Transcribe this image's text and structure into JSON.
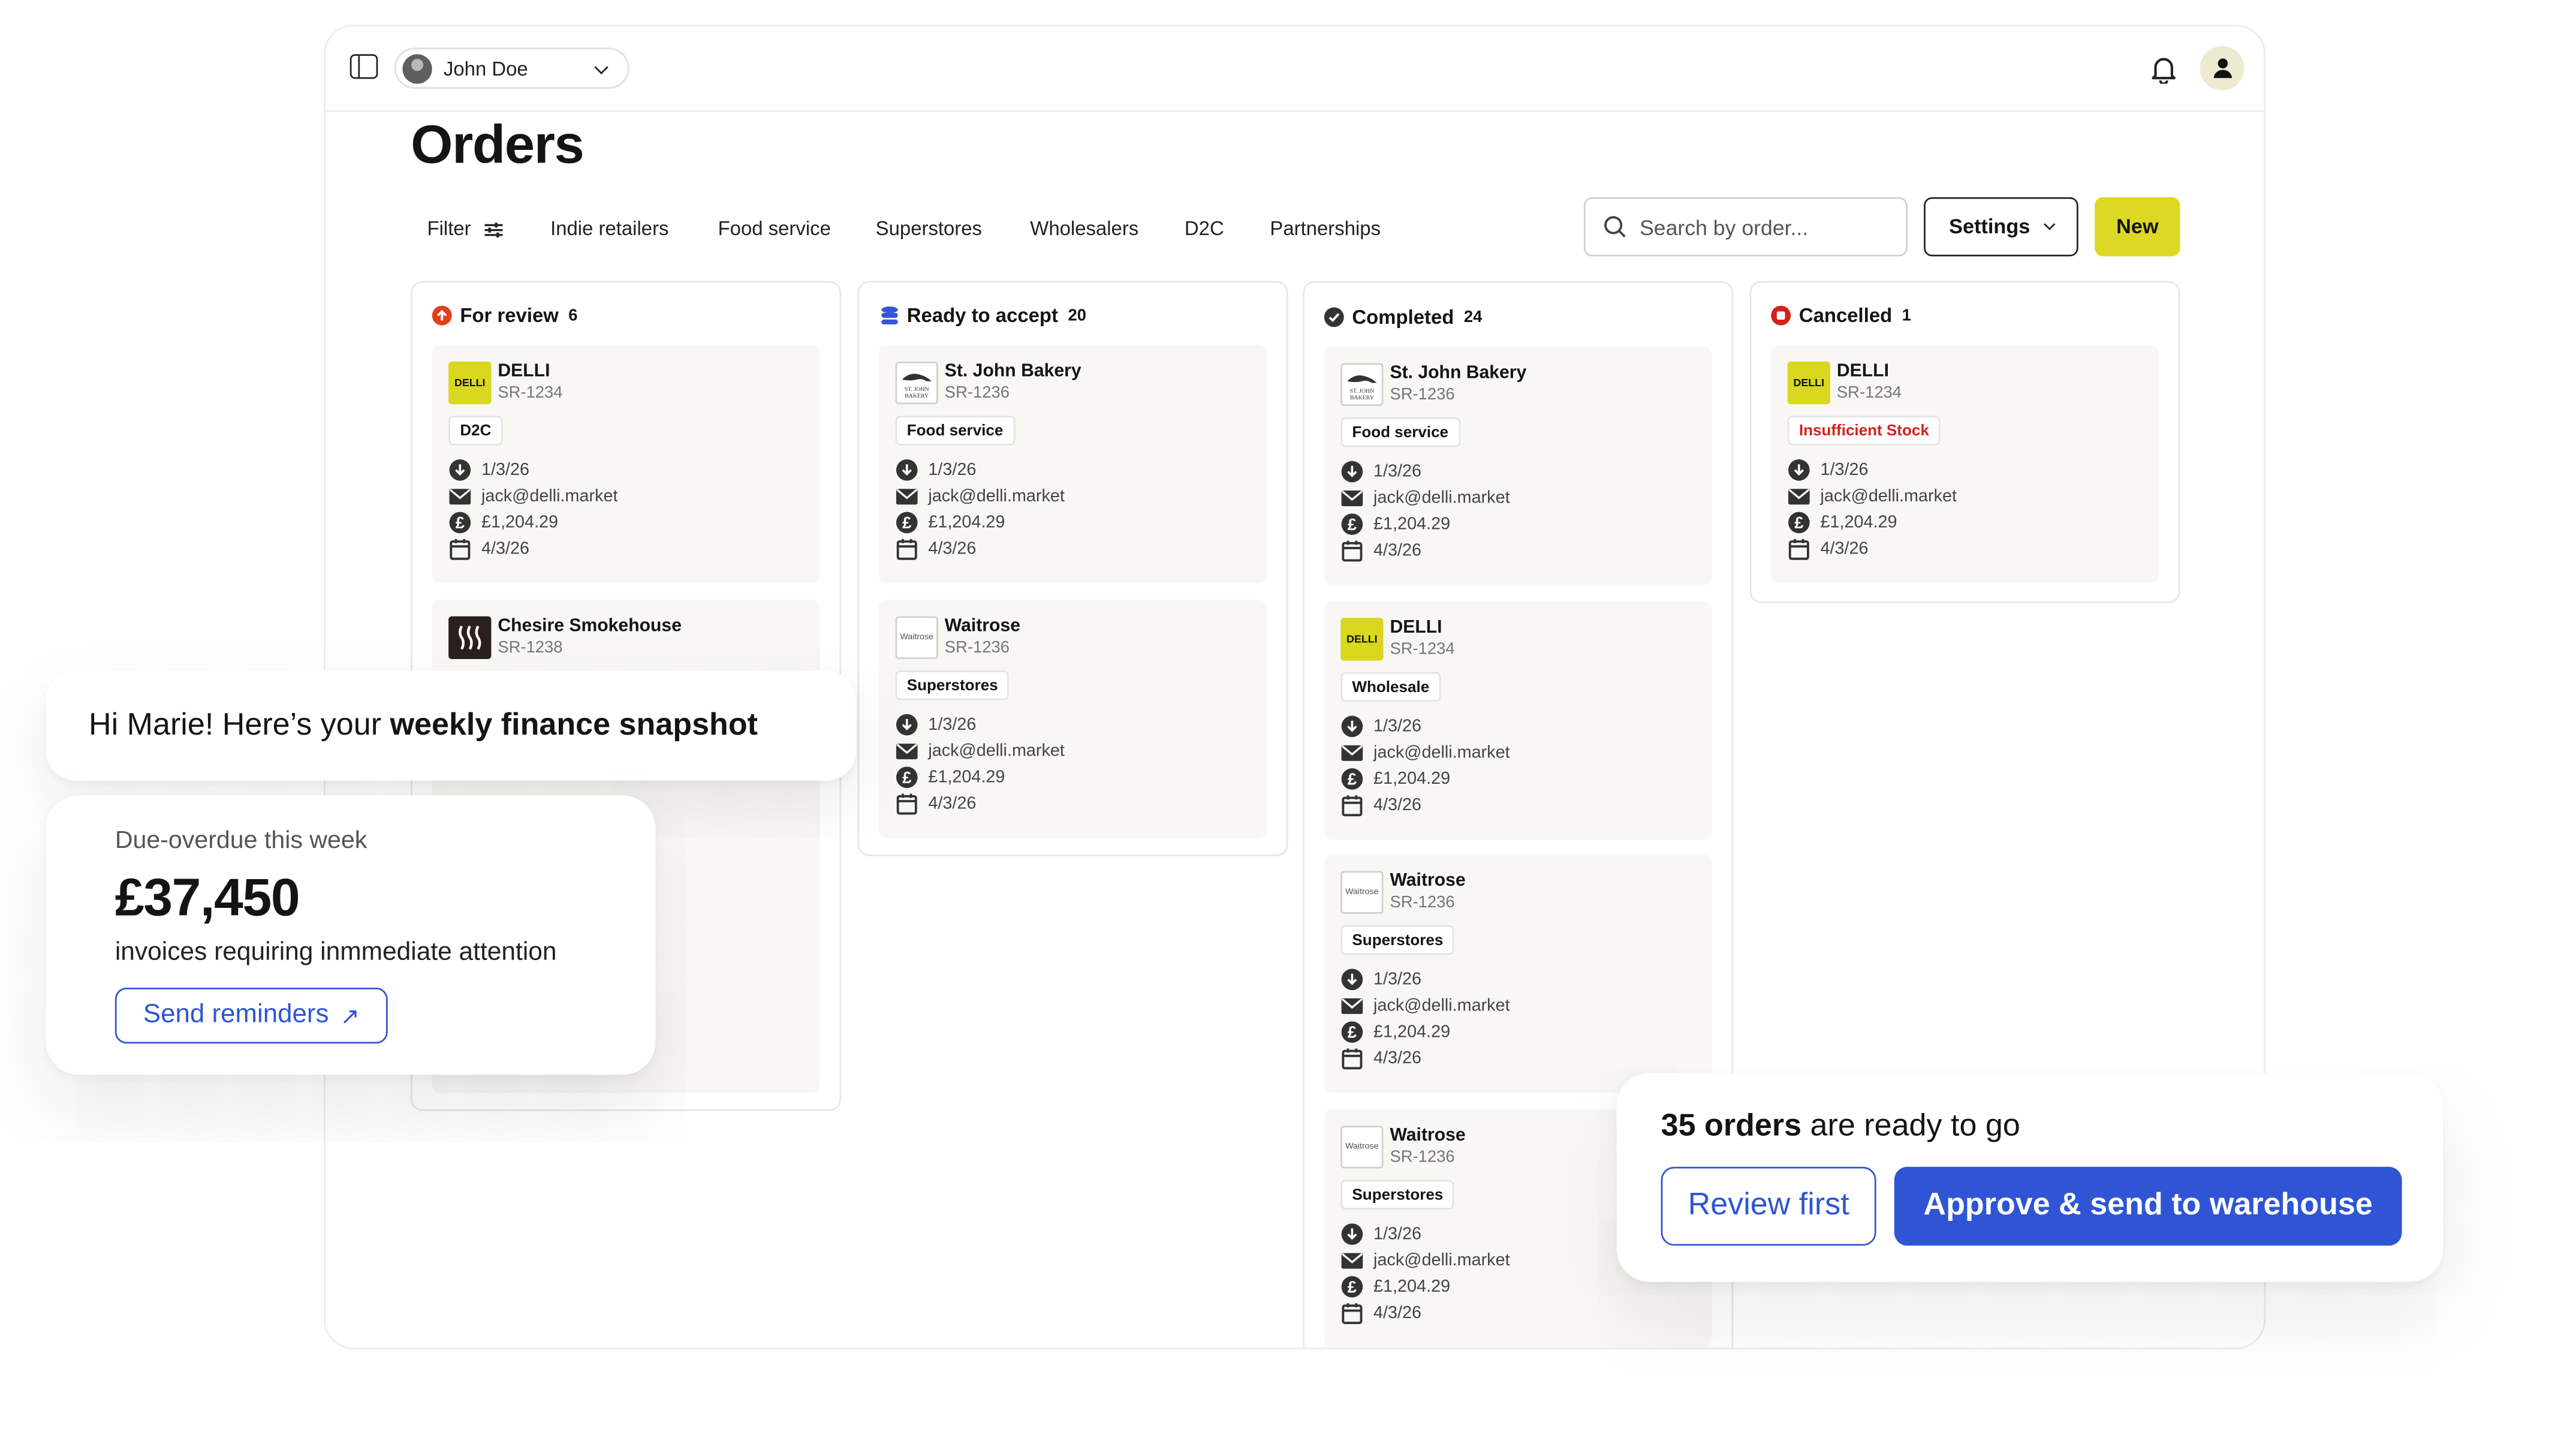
{
  "header": {
    "user_name": "John Doe"
  },
  "page": {
    "title": "Orders"
  },
  "filters": {
    "filter_label": "Filter",
    "segments": [
      "Indie retailers",
      "Food service",
      "Superstores",
      "Wholesalers",
      "D2C",
      "Partnerships"
    ]
  },
  "search": {
    "placeholder": "Search by order..."
  },
  "toolbar": {
    "settings_label": "Settings",
    "new_label": "New"
  },
  "columns": [
    {
      "title": "For review",
      "count": "6",
      "status_color": "#e0401d",
      "cards": [
        {
          "name": "DELLI",
          "ref": "SR-1234",
          "logo": "DELLI",
          "tag": "D2C",
          "tag_alert": false,
          "date": "1/3/26",
          "email": "jack@delli.market",
          "amount": "£1,204.29",
          "due": "4/3/26"
        },
        {
          "name": "Chesire Smokehouse",
          "ref": "SR-1238",
          "logo": "",
          "tag": "",
          "tag_alert": false,
          "date": "",
          "email": "",
          "amount": "",
          "due": ""
        }
      ]
    },
    {
      "title": "Ready to accept",
      "count": "20",
      "status_color": "#3456d8",
      "cards": [
        {
          "name": "St. John Bakery",
          "ref": "SR-1236",
          "logo": "ST. JOHN BAKERY",
          "tag": "Food service",
          "tag_alert": false,
          "date": "1/3/26",
          "email": "jack@delli.market",
          "amount": "£1,204.29",
          "due": "4/3/26"
        },
        {
          "name": "Waitrose",
          "ref": "SR-1236",
          "logo": "Waitrose",
          "tag": "Superstores",
          "tag_alert": false,
          "date": "1/3/26",
          "email": "jack@delli.market",
          "amount": "£1,204.29",
          "due": "4/3/26"
        }
      ]
    },
    {
      "title": "Completed",
      "count": "24",
      "status_color": "#333333",
      "cards": [
        {
          "name": "St. John Bakery",
          "ref": "SR-1236",
          "logo": "ST. JOHN BAKERY",
          "tag": "Food service",
          "tag_alert": false,
          "date": "1/3/26",
          "email": "jack@delli.market",
          "amount": "£1,204.29",
          "due": "4/3/26"
        },
        {
          "name": "DELLI",
          "ref": "SR-1234",
          "logo": "DELLI",
          "tag": "Wholesale",
          "tag_alert": false,
          "date": "1/3/26",
          "email": "jack@delli.market",
          "amount": "£1,204.29",
          "due": "4/3/26"
        },
        {
          "name": "Waitrose",
          "ref": "SR-1236",
          "logo": "Waitrose",
          "tag": "Superstores",
          "tag_alert": false,
          "date": "1/3/26",
          "email": "jack@delli.market",
          "amount": "£1,204.29",
          "due": "4/3/26"
        },
        {
          "name": "Waitrose",
          "ref": "SR-1236",
          "logo": "Waitrose",
          "tag": "Superstores",
          "tag_alert": false,
          "date": "1/3/26",
          "email": "jack@delli.market",
          "amount": "£1,204.29",
          "due": "4/3/26"
        }
      ]
    },
    {
      "title": "Cancelled",
      "count": "1",
      "status_color": "#d3221b",
      "cards": [
        {
          "name": "DELLI",
          "ref": "SR-1234",
          "logo": "DELLI",
          "tag": "Insufficient Stock",
          "tag_alert": true,
          "date": "1/3/26",
          "email": "jack@delli.market",
          "amount": "£1,204.29",
          "due": "4/3/26"
        }
      ]
    }
  ],
  "greeting": {
    "prefix": "Hi Marie! Here’s your ",
    "bold": "weekly finance snapshot"
  },
  "snapshot": {
    "label": "Due-overdue this week",
    "amount": "£37,450",
    "description": "invoices requiring inmmediate attention",
    "button_label": "Send reminders"
  },
  "ready_panel": {
    "count_text": "35 orders",
    "message_suffix": " are ready to go",
    "review_label": "Review first",
    "approve_label": "Approve & send to warehouse"
  },
  "colors": {
    "accent_yellow": "#dcd925",
    "primary_blue": "#2f55d4",
    "alert_red": "#d3221b"
  }
}
